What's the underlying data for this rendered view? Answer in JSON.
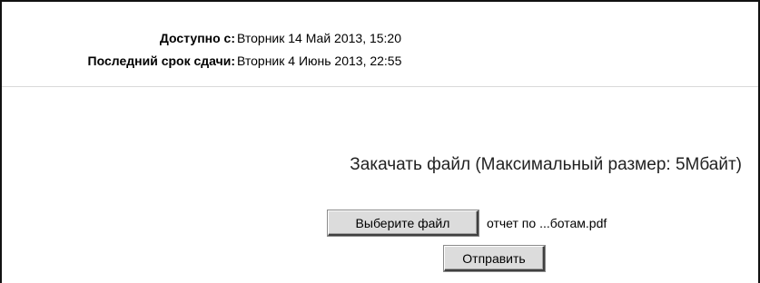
{
  "dates": {
    "available_from_label": "Доступно с:",
    "available_from_value": "Вторник 14 Май 2013, 15:20",
    "due_date_label": "Последний срок сдачи:",
    "due_date_value": "Вторник 4 Июнь 2013, 22:55"
  },
  "upload": {
    "heading": "Закачать файл (Максимальный размер: 5Мбайт)",
    "choose_file_label": "Выберите файл",
    "selected_file_name": "отчет по ...ботам.pdf",
    "submit_label": "Отправить"
  }
}
